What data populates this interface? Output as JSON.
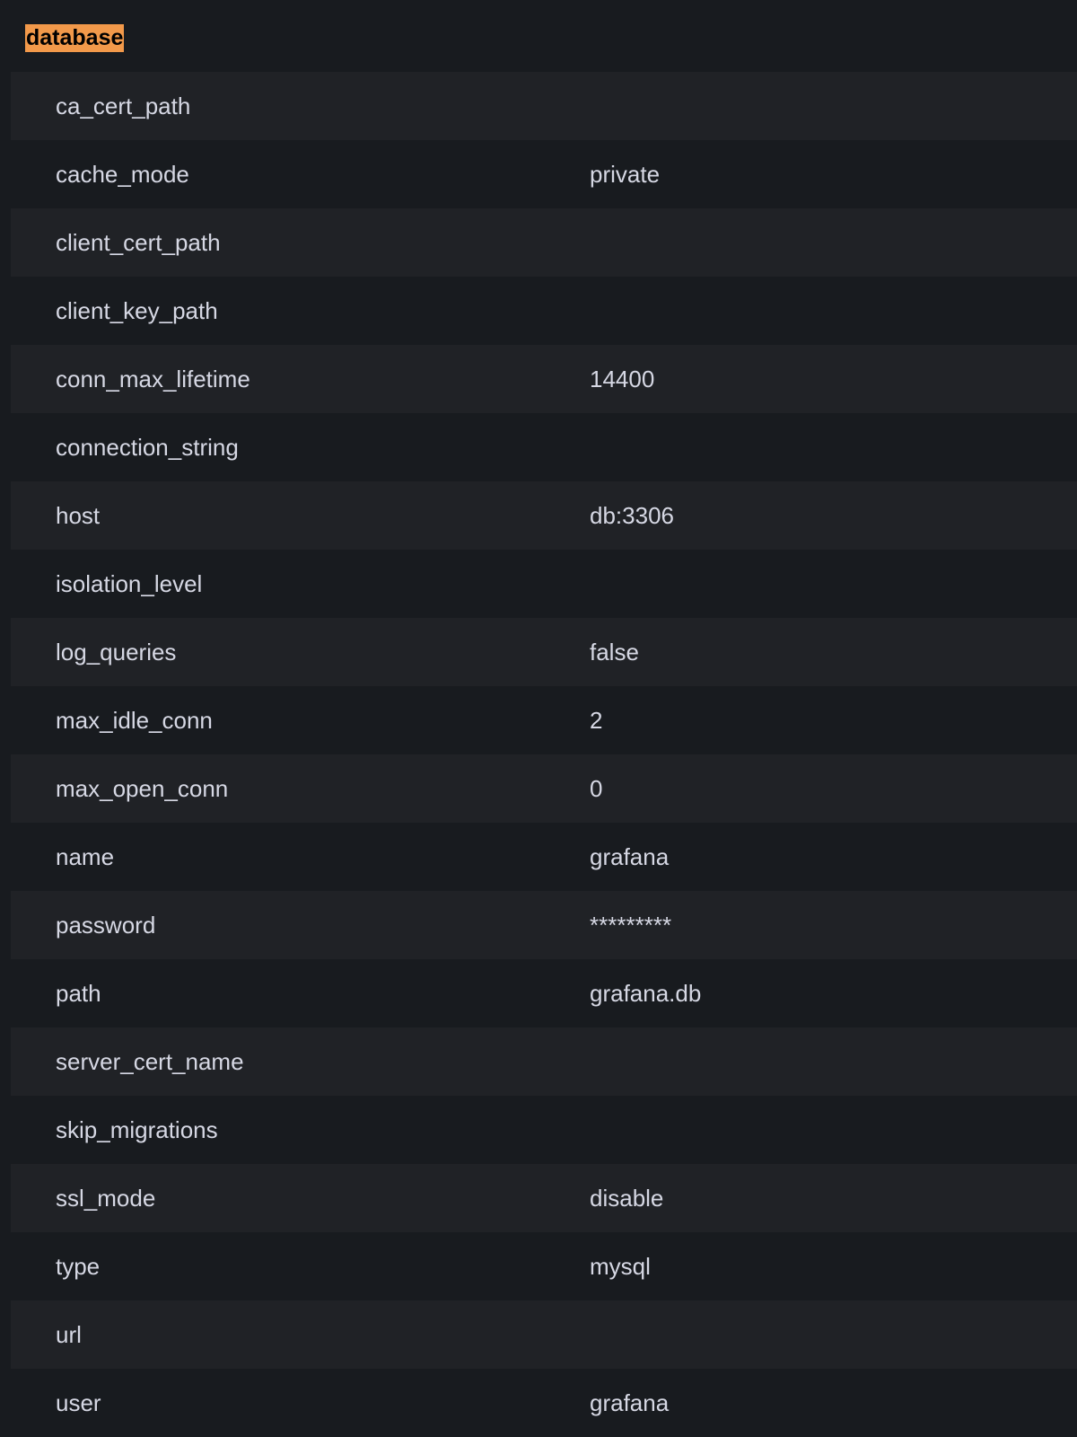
{
  "section": {
    "title": "database"
  },
  "settings": [
    {
      "key": "ca_cert_path",
      "value": ""
    },
    {
      "key": "cache_mode",
      "value": "private"
    },
    {
      "key": "client_cert_path",
      "value": ""
    },
    {
      "key": "client_key_path",
      "value": ""
    },
    {
      "key": "conn_max_lifetime",
      "value": "14400"
    },
    {
      "key": "connection_string",
      "value": ""
    },
    {
      "key": "host",
      "value": "db:3306"
    },
    {
      "key": "isolation_level",
      "value": ""
    },
    {
      "key": "log_queries",
      "value": "false"
    },
    {
      "key": "max_idle_conn",
      "value": "2"
    },
    {
      "key": "max_open_conn",
      "value": "0"
    },
    {
      "key": "name",
      "value": "grafana"
    },
    {
      "key": "password",
      "value": "*********"
    },
    {
      "key": "path",
      "value": "grafana.db"
    },
    {
      "key": "server_cert_name",
      "value": ""
    },
    {
      "key": "skip_migrations",
      "value": ""
    },
    {
      "key": "ssl_mode",
      "value": "disable"
    },
    {
      "key": "type",
      "value": "mysql"
    },
    {
      "key": "url",
      "value": ""
    },
    {
      "key": "user",
      "value": "grafana"
    }
  ],
  "colors": {
    "background": "#181b1f",
    "row_alt": "#202226",
    "text": "#d6d8e4",
    "highlight": "#f2994a"
  }
}
